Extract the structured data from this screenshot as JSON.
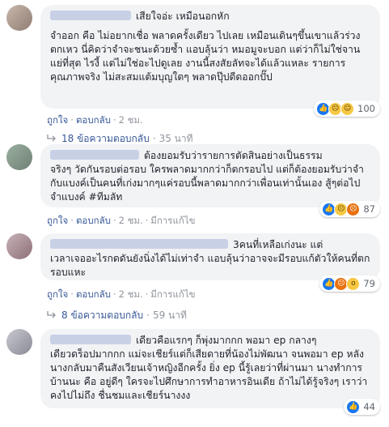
{
  "comments": [
    {
      "avatar": "profile-photo",
      "inline_text": "เสียใจอ่ะ เหมือนอกหัก",
      "body": "จำออก คือ ไม่อยากเชื่อ พลาดครั้งเดียว ไปเลย เหมือนเดินๆขึ้นเขาแล้วร่วงตกเหว นี่คิดว่าจำจะชนะด้วยซ้ำ แอบลุ้นว่า หมอมูจะบอก แต่ว่าก็ไม่ใช่จานแย่ที่สุด ไรงี้ แต่ไม่ใช่อะไปดูเลย งานนี้สงสัยลัทจะได้แล้วแหละ รายการคุณภาพจริง ไม่สะสมแต้มบุญใดๆ พลาดปุ๊ปดีดออกปั๊ป",
      "reactions": [
        "like-icon",
        "sad-icon",
        "haha-icon"
      ],
      "reaction_count": "100",
      "actions": {
        "like": "ถูกใจ",
        "reply": "ตอบกลับ",
        "time": "2 ชม.",
        "edited": ""
      },
      "replies": {
        "label": "18 ข้อความตอบกลับ",
        "time": "35 นาที"
      }
    },
    {
      "avatar": "profile-photo",
      "inline_text": "ต้องยอมรับว่ารายการตัดสินอย่างเป็นธรรม",
      "body": "จริงๆ วัดกันรอบต่อรอบ ใครพลาดมากกว่าก็ตกรอบไป แต่ก็ต้องยอมรับว่าจำกับแบงค์เป็นคนที่เก่งมากๆแค่รอบนี้พลาดมากกว่าเพื่อนเท่านั้นเอง สู้ๆต่อไปจำแบงค์ #ทีมลัท",
      "reactions": [
        "like-icon",
        "sad-icon",
        "angry-icon"
      ],
      "reaction_count": "87",
      "actions": {
        "like": "ถูกใจ",
        "reply": "ตอบกลับ",
        "time": "2 ชม.",
        "edited": "มีการแก้ไข"
      },
      "replies": null
    },
    {
      "avatar": "profile-photo",
      "inline_text": "3คนที่เหลือเก่งนะ แต่",
      "body": "เวลาเจออะไรกดดันยังนิ่งได้ไม่เท่าจำ แอบลุ้นว่าอาจจะมีรอบแก้ตัวให้คนที่ตกรอบแหะ",
      "reactions": [
        "like-icon",
        "angry-icon",
        "wow-icon"
      ],
      "reaction_count": "79",
      "actions": {
        "like": "ถูกใจ",
        "reply": "ตอบกลับ",
        "time": "2 ชม.",
        "edited": "มีการแก้ไข"
      },
      "replies": {
        "label": "8 ข้อความตอบกลับ",
        "time": "59 นาที"
      }
    },
    {
      "avatar": "profile-photo",
      "inline_text": "เดียวคือแรกๆ ก็พุ่งมากกก พอมา ep กลางๆ",
      "body": "เดียวดร็อปมากกก แม่จะเชียร์แต่ก็เสียดายที่น้องไม่พัฒนา จนพอมา ep หลัง นางกลับมาคืนสังเวียนเจ้าหญิงอีกครั้ง ยิ่ง ep นี้รู้เลยว่าที่ผ่านมา นางทำการบ้านนะ คือ อยู่ดีๆ ใครจะไปศึกษาการทำอาหารอินเดีย ถ้าไม่ได้รู้จริงๆ เราว่าคงไปไม่ถึง ชื่นชมและเชียร์นางงง",
      "reactions": [
        "like-icon"
      ],
      "reaction_count": "44",
      "actions": null,
      "replies": null
    }
  ]
}
